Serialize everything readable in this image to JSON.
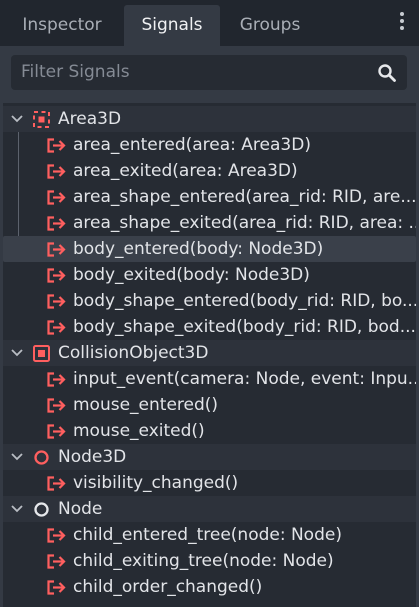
{
  "tabs": [
    {
      "label": "Inspector",
      "active": false
    },
    {
      "label": "Signals",
      "active": true
    },
    {
      "label": "Groups",
      "active": false
    }
  ],
  "search": {
    "placeholder": "Filter Signals"
  },
  "colors": {
    "signal_icon": "#ff5f5f",
    "text": "#e2e4e8",
    "background": "#262b33"
  },
  "tree": [
    {
      "type": "group",
      "label": "Area3D",
      "icon": "area3d-icon"
    },
    {
      "type": "signal",
      "label": "area_entered(area: Area3D)"
    },
    {
      "type": "signal",
      "label": "area_exited(area: Area3D)"
    },
    {
      "type": "signal",
      "label": "area_shape_entered(area_rid: RID, are..."
    },
    {
      "type": "signal",
      "label": "area_shape_exited(area_rid: RID, area: ..."
    },
    {
      "type": "signal",
      "label": "body_entered(body: Node3D)",
      "selected": true
    },
    {
      "type": "signal",
      "label": "body_exited(body: Node3D)"
    },
    {
      "type": "signal",
      "label": "body_shape_entered(body_rid: RID, bo..."
    },
    {
      "type": "signal",
      "label": "body_shape_exited(body_rid: RID, bod..."
    },
    {
      "type": "group",
      "label": "CollisionObject3D",
      "icon": "collision-object-3d-icon"
    },
    {
      "type": "signal",
      "label": "input_event(camera: Node, event: Inpu..."
    },
    {
      "type": "signal",
      "label": "mouse_entered()"
    },
    {
      "type": "signal",
      "label": "mouse_exited()"
    },
    {
      "type": "group",
      "label": "Node3D",
      "icon": "node3d-icon"
    },
    {
      "type": "signal",
      "label": "visibility_changed()"
    },
    {
      "type": "group",
      "label": "Node",
      "icon": "node-icon"
    },
    {
      "type": "signal",
      "label": "child_entered_tree(node: Node)"
    },
    {
      "type": "signal",
      "label": "child_exiting_tree(node: Node)"
    },
    {
      "type": "signal",
      "label": "child_order_changed()"
    }
  ]
}
